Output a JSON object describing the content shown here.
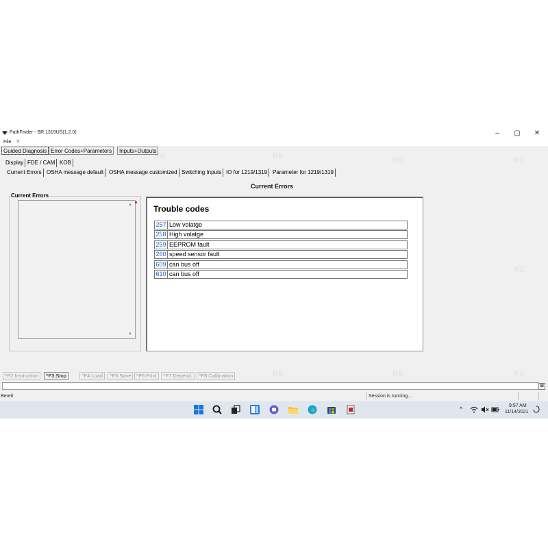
{
  "window": {
    "title": "PathFinder - BR 1319US(1.2.0)",
    "minimize_glyph": "–",
    "maximize_glyph": "▢",
    "close_glyph": "✕"
  },
  "menu": [
    "File",
    "?"
  ],
  "tabs_top": [
    "Guided Diagnosis",
    "Error Codes+Parameters",
    "Inputs+Outputs"
  ],
  "tabs_second": [
    "Display",
    "FDE / CAM",
    "KOB"
  ],
  "tabs_third": [
    "Current Errors",
    "OSHA message default",
    "OSHA message customized",
    "Switching Inputs",
    "IO for 1219/1319",
    "Parameter for 1219/1319"
  ],
  "section_title": "Current Errors",
  "left_group": {
    "label": "Current Errors",
    "scroll_up": "▲",
    "scroll_down": "▼"
  },
  "trouble_codes": {
    "title": "Trouble codes",
    "rows": [
      {
        "code": "257",
        "description": "Low volatge"
      },
      {
        "code": "258",
        "description": "High volatge"
      },
      {
        "code": "259",
        "description": "EEPROM fault"
      },
      {
        "code": "260",
        "description": "speed sensor fault"
      },
      {
        "code": "609",
        "description": "can bus off"
      },
      {
        "code": "610",
        "description": "can bus off"
      }
    ]
  },
  "function_keys": [
    {
      "label": "^F2:Instruction",
      "enabled": false
    },
    {
      "label": "^F3:Stop",
      "enabled": true
    },
    {
      "label": "^F4:Load",
      "enabled": false
    },
    {
      "label": "^F5:Save",
      "enabled": false
    },
    {
      "label": "^F6:Print",
      "enabled": false
    },
    {
      "label": "^F7:Depend.",
      "enabled": false
    },
    {
      "label": "^F8:Calibration",
      "enabled": false
    }
  ],
  "progress_button": "⊠",
  "status": {
    "left": "Bereit",
    "middle": "Session is running..."
  },
  "taskbar": {
    "icons": [
      "windows-start-icon",
      "search-icon",
      "task-view-icon",
      "widgets-icon",
      "chat-icon",
      "file-explorer-icon",
      "edge-icon",
      "store-icon",
      "pathfinder-app-icon"
    ],
    "tray_chevron": "^",
    "time": "9:57 AM",
    "date": "11/14/2021"
  },
  "watermark": "RE",
  "colors": {
    "code_blue": "#1a5fbf",
    "taskbar_bg": "#dfe6ee",
    "window_bg": "#f0f0f0"
  }
}
